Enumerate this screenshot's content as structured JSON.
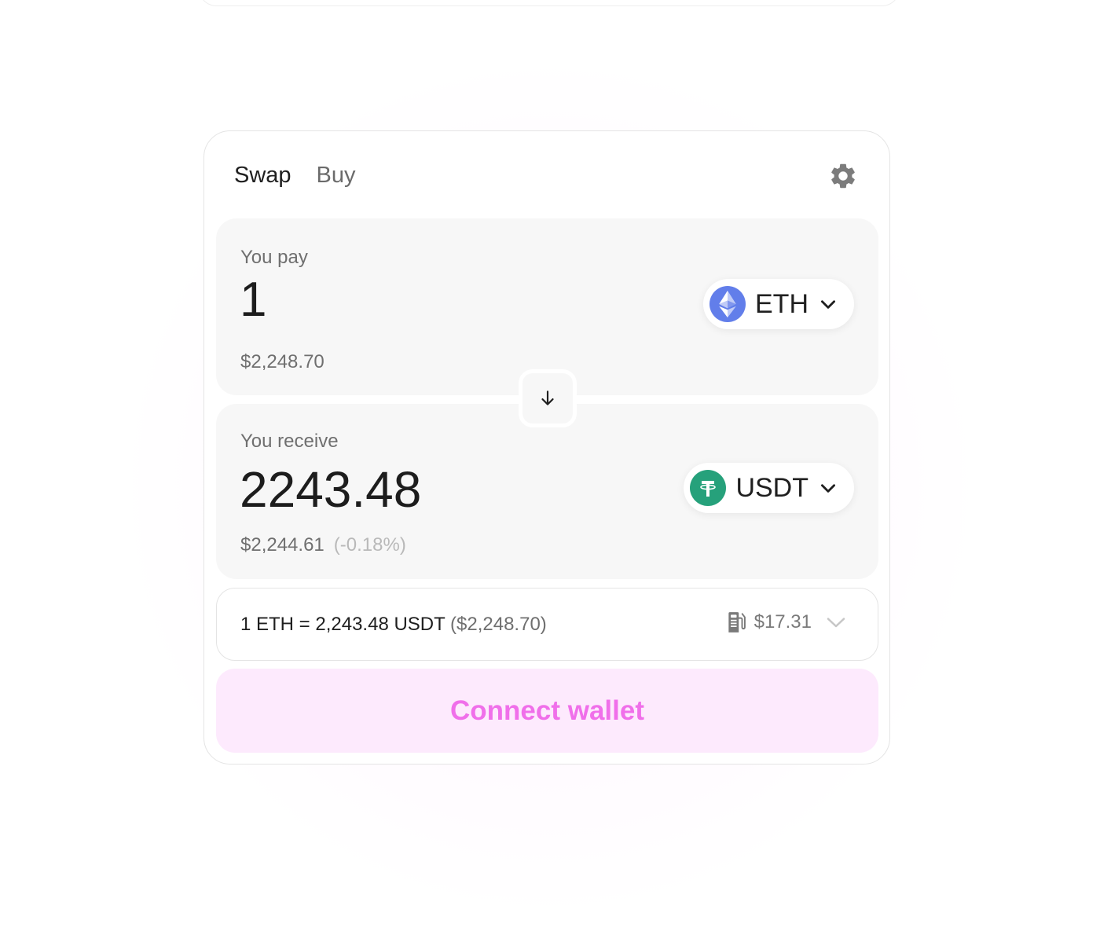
{
  "tabs": {
    "swap": "Swap",
    "buy": "Buy"
  },
  "settings": {
    "icon": "gear-icon"
  },
  "pay": {
    "label": "You pay",
    "amount": "1",
    "usd_value": "$2,248.70",
    "token": {
      "symbol": "ETH",
      "icon": "ethereum-icon",
      "color": "#627EEA"
    }
  },
  "receive": {
    "label": "You receive",
    "amount": "2243.48",
    "usd_value": "$2,244.61",
    "price_impact": "(-0.18%)",
    "token": {
      "symbol": "USDT",
      "icon": "tether-icon",
      "color": "#26A17B"
    }
  },
  "switch": {
    "icon": "arrow-down-icon"
  },
  "rate": {
    "text": "1 ETH = 2,243.48 USDT",
    "usd": "($2,248.70)",
    "gas_icon": "gas-pump-icon",
    "gas_fee": "$17.31",
    "expand_icon": "chevron-down-icon"
  },
  "connect_button": {
    "label": "Connect wallet"
  },
  "colors": {
    "accent": "#F06FEA",
    "accent_bg": "#FDEAFD",
    "panel_bg": "#F7F7F7"
  }
}
